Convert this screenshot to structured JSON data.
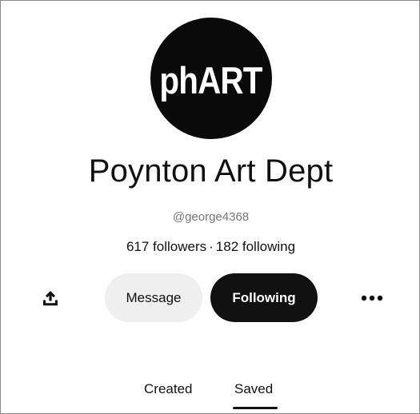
{
  "profile": {
    "avatar_text": "phART",
    "name": "Poynton Art Dept",
    "username": "@george4368",
    "followers": "617 followers",
    "separator": "·",
    "following": "182 following"
  },
  "actions": {
    "share_icon": "share-upload-icon",
    "message_label": "Message",
    "following_label": "Following",
    "more_icon": "more-horizontal-icon"
  },
  "tabs": [
    {
      "label": "Created",
      "selected": false
    },
    {
      "label": "Saved",
      "selected": true
    }
  ],
  "colors": {
    "primary_button": "#111111",
    "secondary_button": "#efefef",
    "muted_text": "#767676"
  }
}
